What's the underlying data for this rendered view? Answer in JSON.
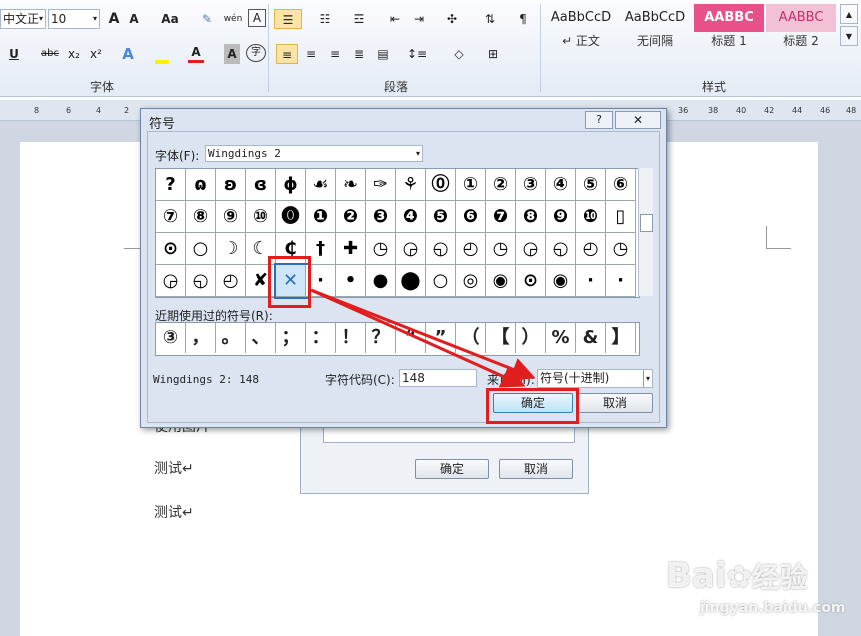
{
  "ribbon": {
    "font_name": "中文正",
    "font_size": "10",
    "top_buttons": [
      "A",
      "A",
      "Aa",
      "wén",
      "A"
    ],
    "format_buttons": [
      "U",
      "abc",
      "x₂",
      "x²",
      "A",
      "A",
      "A",
      "字"
    ],
    "groups": {
      "font": "字体",
      "paragraph": "段落",
      "styles": "样式"
    },
    "styles": [
      {
        "preview": "AaBbCcD",
        "name": "↵ 正文"
      },
      {
        "preview": "AaBbCcD",
        "name": "无间隔"
      },
      {
        "preview": "AABBC",
        "name": "标题 1"
      },
      {
        "preview": "AABBC",
        "name": "标题 2"
      }
    ]
  },
  "ruler_left": [
    "8",
    "6",
    "4",
    "2"
  ],
  "ruler_right": [
    "36",
    "38",
    "40",
    "42",
    "44",
    "46",
    "48"
  ],
  "doc": {
    "line1": "使用图片",
    "line2": "测试↵",
    "line3": "测试↵"
  },
  "behind_dialog": {
    "ok": "确定",
    "cancel": "取消"
  },
  "dialog": {
    "title": "符号",
    "help": "?",
    "font_label": "字体(F):",
    "font_value": "Wingdings 2",
    "symbols": [
      "?",
      "ɷ",
      "ʚ",
      "ɞ",
      "ɸ",
      "☙",
      "❧",
      "✑",
      "⚘",
      "⓪",
      "①",
      "②",
      "③",
      "④",
      "⑤",
      "⑥",
      "⑦",
      "⑧",
      "⑨",
      "⑩",
      "⓿",
      "❶",
      "❷",
      "❸",
      "❹",
      "❺",
      "❻",
      "❼",
      "❽",
      "❾",
      "❿",
      "▯",
      "⊙",
      "○",
      "☽",
      "☾",
      "₵",
      "†",
      "✚",
      "◷",
      "◶",
      "◵",
      "◴",
      "◷",
      "◶",
      "◵",
      "◴",
      "◷",
      "◶",
      "◵",
      "◴",
      "✘",
      "✕",
      "·",
      "•",
      "●",
      "⬤",
      "○",
      "◎",
      "◉",
      "⊙",
      "◉",
      "·",
      "·"
    ],
    "recent_label": "近期使用过的符号(R):",
    "recent": [
      "③",
      "，",
      "。",
      "、",
      "；",
      "：",
      "！",
      "？",
      "“",
      "”",
      "（",
      "【",
      "）",
      "%",
      "&",
      "】"
    ],
    "char_name": "Wingdings 2: 148",
    "code_label": "字符代码(C):",
    "code_value": "148",
    "from_label": "来自(M):",
    "from_value": "符号(十进制)",
    "ok": "确定",
    "cancel": "取消"
  },
  "watermark": {
    "brand": "Bai",
    "brand2": "经验",
    "url": "jingyan.baidu.com"
  },
  "colors": {
    "highlight": "#e01e1e",
    "title1": "#e8508a",
    "title2": "#f3c1d6"
  }
}
